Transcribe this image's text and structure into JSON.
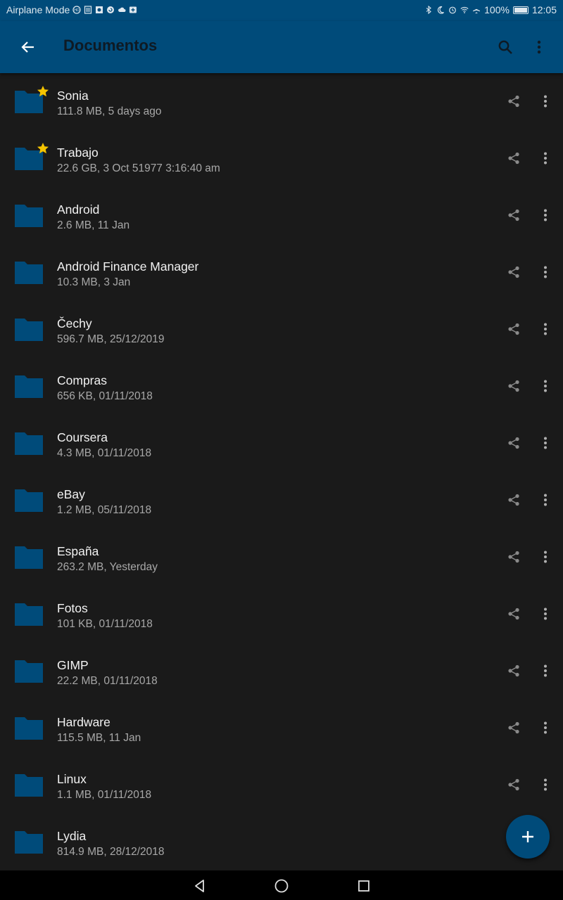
{
  "status_bar": {
    "left_text": "Airplane Mode",
    "battery": "100%",
    "time": "12:05",
    "icons_left": [
      "hd-icon",
      "notes-icon",
      "photo-icon",
      "sync-icon",
      "cloud-icon",
      "plus-box-icon"
    ],
    "icons_right": [
      "bluetooth-icon",
      "moon-icon",
      "alarm-icon",
      "wifi-icon",
      "airplane-icon",
      "battery-icon"
    ]
  },
  "appbar": {
    "title": "Documentos",
    "back_icon": "arrow-left-icon",
    "search_icon": "search-icon",
    "more_icon": "more-vertical-icon"
  },
  "colors": {
    "primary": "#004b7a",
    "folder": "#004b7a",
    "star": "#f5c400",
    "background": "#1a1a1a"
  },
  "files": [
    {
      "name": "Sonia",
      "meta": "111.8 MB, 5 days ago",
      "starred": true
    },
    {
      "name": "Trabajo",
      "meta": "22.6 GB, 3 Oct 51977 3:16:40 am",
      "starred": true
    },
    {
      "name": "Android",
      "meta": "2.6 MB, 11 Jan",
      "starred": false
    },
    {
      "name": "Android Finance Manager",
      "meta": "10.3 MB, 3 Jan",
      "starred": false
    },
    {
      "name": "Čechy",
      "meta": "596.7 MB, 25/12/2019",
      "starred": false
    },
    {
      "name": "Compras",
      "meta": "656 KB, 01/11/2018",
      "starred": false
    },
    {
      "name": "Coursera",
      "meta": "4.3 MB, 01/11/2018",
      "starred": false
    },
    {
      "name": "eBay",
      "meta": "1.2 MB, 05/11/2018",
      "starred": false
    },
    {
      "name": "España",
      "meta": "263.2 MB, Yesterday",
      "starred": false
    },
    {
      "name": "Fotos",
      "meta": "101 KB, 01/11/2018",
      "starred": false
    },
    {
      "name": "GIMP",
      "meta": "22.2 MB, 01/11/2018",
      "starred": false
    },
    {
      "name": "Hardware",
      "meta": "115.5 MB, 11 Jan",
      "starred": false
    },
    {
      "name": "Linux",
      "meta": "1.1 MB, 01/11/2018",
      "starred": false
    },
    {
      "name": "Lydia",
      "meta": "814.9 MB, 28/12/2018",
      "starred": false
    }
  ],
  "fab": {
    "icon": "plus-icon"
  },
  "navbar": {
    "icons": [
      "back-triangle-icon",
      "home-circle-icon",
      "recents-square-icon"
    ]
  }
}
